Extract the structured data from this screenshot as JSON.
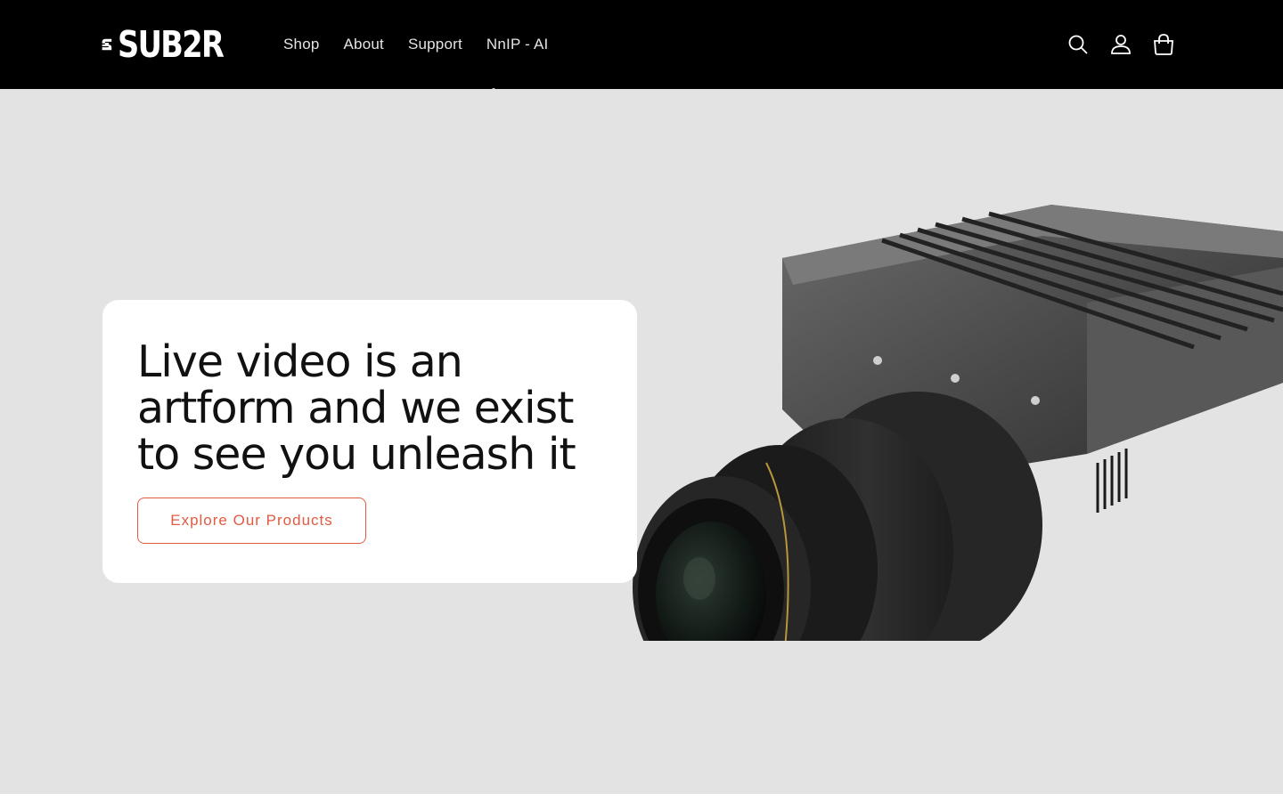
{
  "header": {
    "logo_text": "SUB2R",
    "nav": [
      {
        "label": "Shop"
      },
      {
        "label": "About"
      },
      {
        "label": "Support"
      },
      {
        "label": "NnIP - AI"
      }
    ],
    "icons": [
      "search-icon",
      "account-icon",
      "cart-icon"
    ]
  },
  "hero": {
    "headline": "Live video is an artform and we exist to see you unleash it",
    "cta_label": "Explore Our Products",
    "image": "camera-image"
  },
  "colors": {
    "header_bg": "#000000",
    "hero_bg": "#e3e3e3",
    "accent": "#e25a42",
    "text": "#111111"
  }
}
